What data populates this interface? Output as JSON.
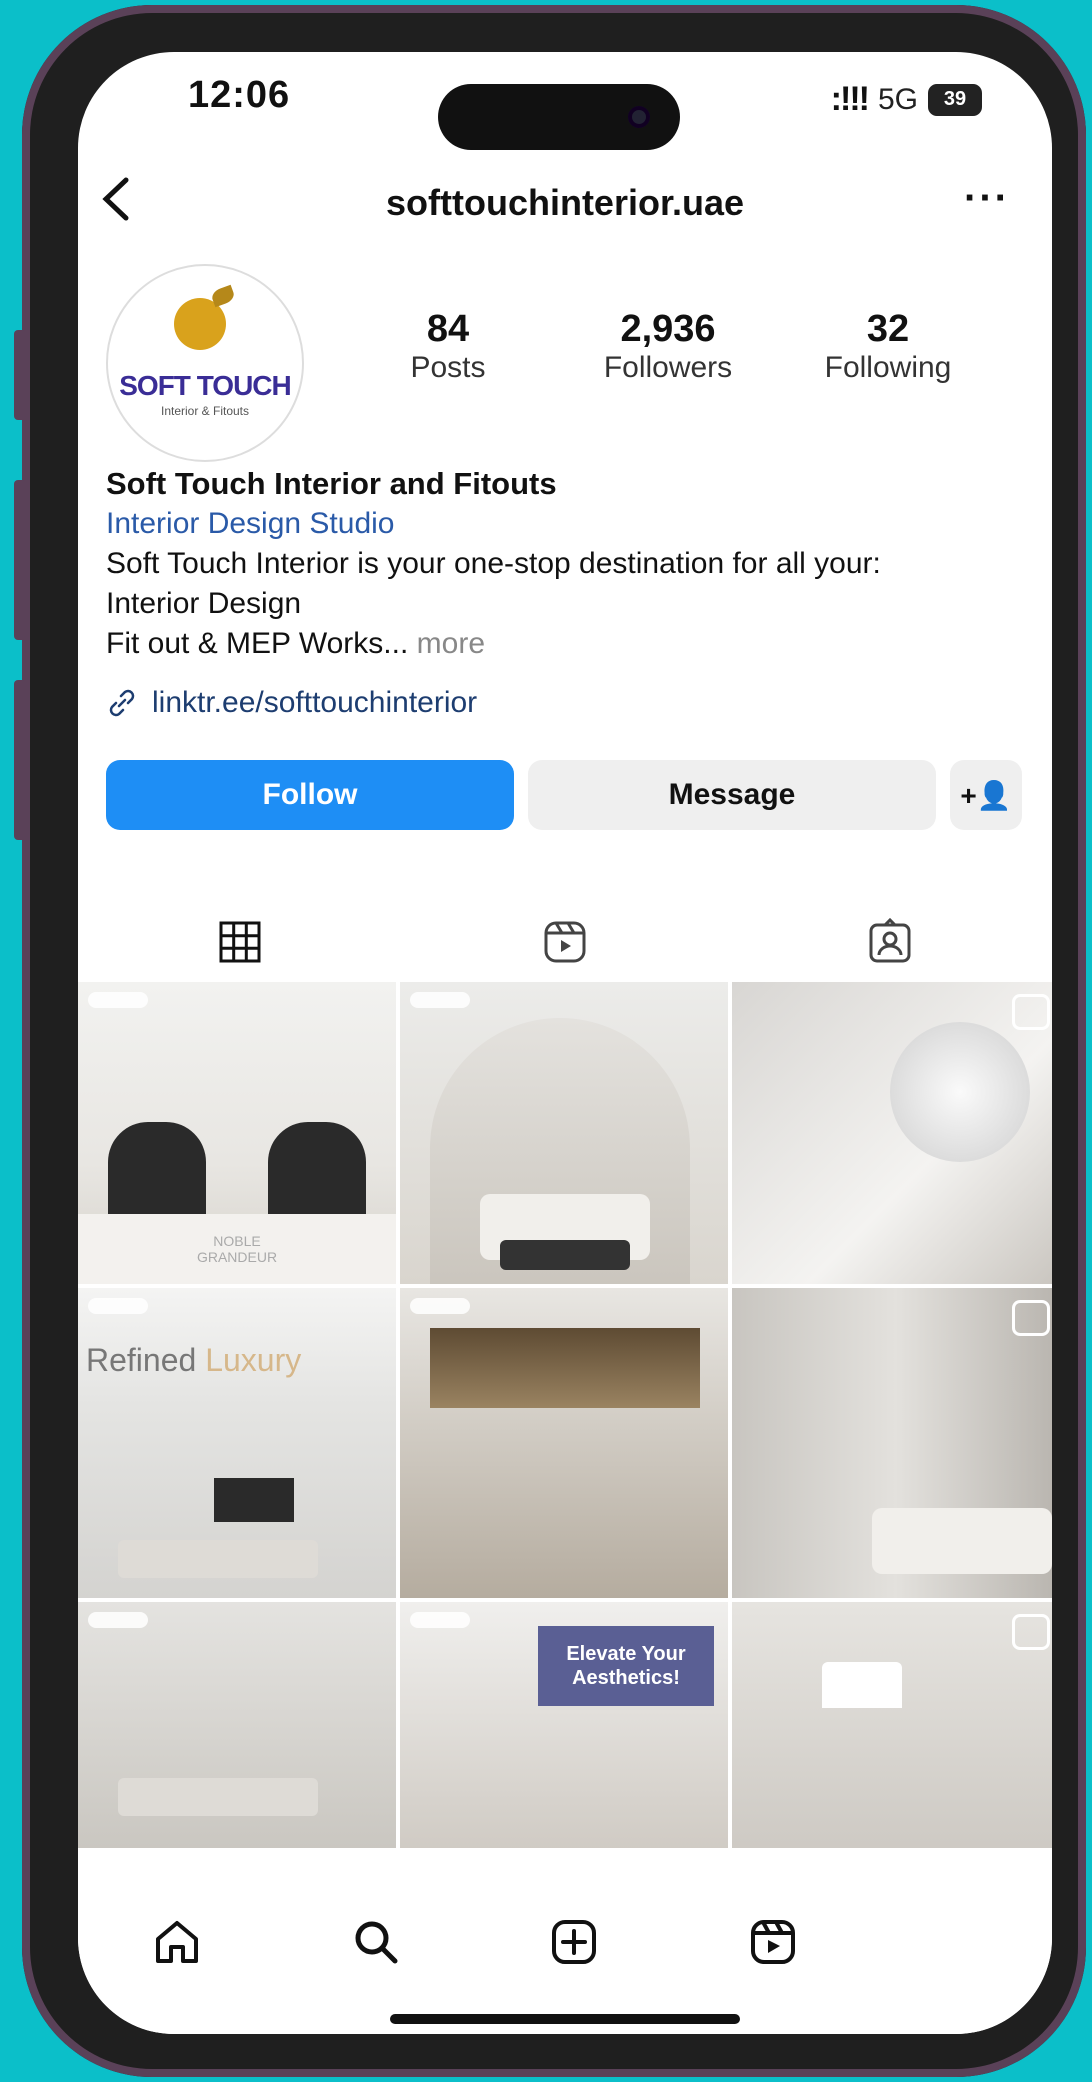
{
  "status_bar": {
    "time": "12:06",
    "signal": ":!!!",
    "network": "5G",
    "battery": "39"
  },
  "header": {
    "username": "softtouchinterior.uae",
    "back_icon": "chevron-left-icon",
    "more_icon": "ellipsis-icon"
  },
  "profile": {
    "logo_text": "SOFT TOUCH",
    "logo_sub": "Interior & Fitouts",
    "stats": [
      {
        "value": "84",
        "label": "Posts"
      },
      {
        "value": "2,936",
        "label": "Followers"
      },
      {
        "value": "32",
        "label": "Following"
      }
    ],
    "name": "Soft Touch Interior and Fitouts",
    "category": "Interior Design Studio",
    "bio_line1": "Soft Touch Interior is your one-stop destination for all your:",
    "bio_line2": "Interior Design",
    "bio_line3": "Fit out & MEP Works...",
    "bio_more": " more",
    "link": "linktr.ee/softtouchinterior"
  },
  "actions": {
    "follow": "Follow",
    "message": "Message",
    "add_person": "+👤"
  },
  "tabs": [
    {
      "name": "grid",
      "icon": "grid-icon"
    },
    {
      "name": "reels",
      "icon": "reels-icon"
    },
    {
      "name": "tagged",
      "icon": "tagged-icon"
    }
  ],
  "posts": {
    "p1_caption": "NOBLE\nGRANDEUR",
    "p4_title_a": "Refined ",
    "p4_title_b": "Luxury",
    "p8_caption": "Elevate Your\nAesthetics!"
  },
  "bottom_nav": [
    {
      "name": "home",
      "icon": "home-icon"
    },
    {
      "name": "search",
      "icon": "search-icon"
    },
    {
      "name": "create",
      "icon": "plus-square-icon"
    },
    {
      "name": "reels",
      "icon": "reels-icon"
    }
  ],
  "colors": {
    "accent": "#1e8ef5",
    "background": "#0bbfc9",
    "category": "#2a5aa8"
  }
}
